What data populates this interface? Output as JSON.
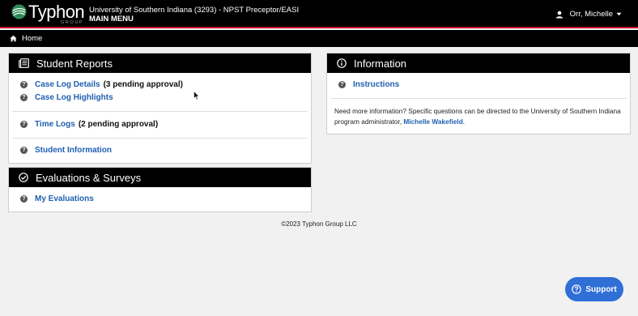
{
  "header": {
    "logo_text": "Typhon",
    "logo_sub": "GROUP",
    "institution": "University of Southern Indiana (3293) - NPST Preceptor/EASI",
    "menu_title": "MAIN MENU",
    "user_name": "Orr, Michelle"
  },
  "breadcrumb": {
    "home_label": "Home"
  },
  "student_reports": {
    "title": "Student Reports",
    "items": [
      {
        "label": "Case Log Details",
        "note": "(3 pending approval)"
      },
      {
        "label": "Case Log Highlights",
        "note": ""
      },
      {
        "label": "Time Logs",
        "note": "(2 pending approval)"
      },
      {
        "label": "Student Information",
        "note": ""
      }
    ]
  },
  "evaluations": {
    "title": "Evaluations & Surveys",
    "items": [
      {
        "label": "My Evaluations"
      }
    ]
  },
  "information": {
    "title": "Information",
    "link_label": "Instructions",
    "text_before": "Need more information? Specific questions can be directed to the University of Southern Indiana program administrator, ",
    "admin_name": "Michelle Wakefield",
    "text_after": "."
  },
  "footer": {
    "copyright": "©2023 Typhon Group LLC"
  },
  "support": {
    "label": "Support"
  },
  "colors": {
    "accent_red": "#c8102e",
    "link_blue": "#1f5fb0",
    "support_blue": "#2f6fd6"
  },
  "icons": [
    "typhon-logo-icon",
    "user-icon",
    "caret-down-icon",
    "home-icon",
    "report-icon",
    "check-circle-icon",
    "info-icon",
    "question-icon",
    "support-icon"
  ]
}
